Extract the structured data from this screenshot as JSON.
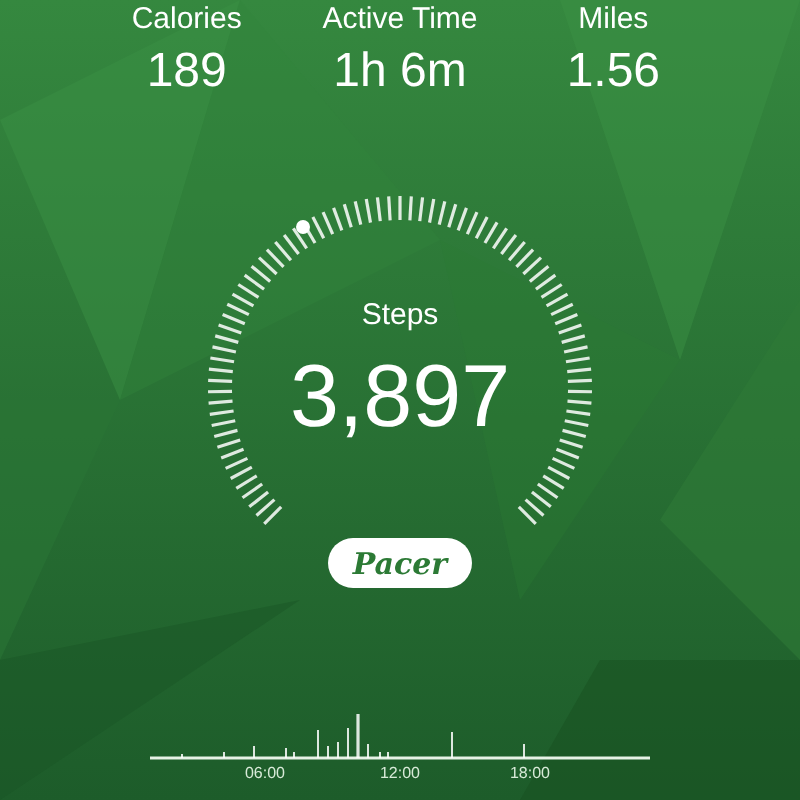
{
  "stats": [
    {
      "label": "Calories",
      "value": "189"
    },
    {
      "label": "Active Time",
      "value": "1h 6m"
    },
    {
      "label": "Miles",
      "value": "1.56"
    }
  ],
  "steps": {
    "label": "Steps",
    "value": "3,897"
  },
  "brand": {
    "label": "Pacer"
  },
  "activity_chart": {
    "time_labels": [
      "06:00",
      "12:00",
      "18:00"
    ]
  }
}
